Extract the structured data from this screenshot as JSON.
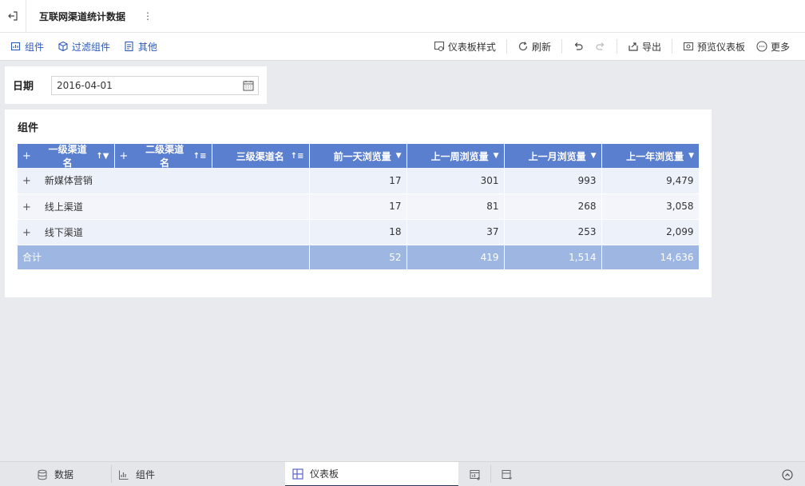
{
  "titlebar": {
    "title": "互联网渠道统计数据",
    "menu": "⋮"
  },
  "toolbar": {
    "left": [
      {
        "label": "组件",
        "icon": "chart-add-icon"
      },
      {
        "label": "过滤组件",
        "icon": "filter-cube-icon"
      },
      {
        "label": "其他",
        "icon": "doc-add-icon"
      }
    ],
    "dashboard_style": "仪表板样式",
    "refresh": "刷新",
    "export": "导出",
    "preview": "预览仪表板",
    "more": "更多"
  },
  "filter": {
    "label": "日期",
    "value": "2016-04-01"
  },
  "component": {
    "title": "组件",
    "headers": [
      "一级渠道名",
      "二级渠道名",
      "三级渠道名",
      "前一天浏览量",
      "上一周浏览量",
      "上一月浏览量",
      "上一年浏览量"
    ],
    "rows": [
      {
        "name": "新媒体营销",
        "values": [
          "17",
          "301",
          "993",
          "9,479"
        ]
      },
      {
        "name": "线上渠道",
        "values": [
          "17",
          "81",
          "268",
          "3,058"
        ]
      },
      {
        "name": "线下渠道",
        "values": [
          "18",
          "37",
          "253",
          "2,099"
        ]
      }
    ],
    "total": {
      "label": "合计",
      "values": [
        "52",
        "419",
        "1,514",
        "14,636"
      ]
    }
  },
  "bottom_tabs": {
    "data": "数据",
    "component": "组件",
    "dashboard": "仪表板"
  },
  "colors": {
    "header": "#5b7fcf",
    "total": "#9eb6e2",
    "accent": "#2d5ab8"
  }
}
